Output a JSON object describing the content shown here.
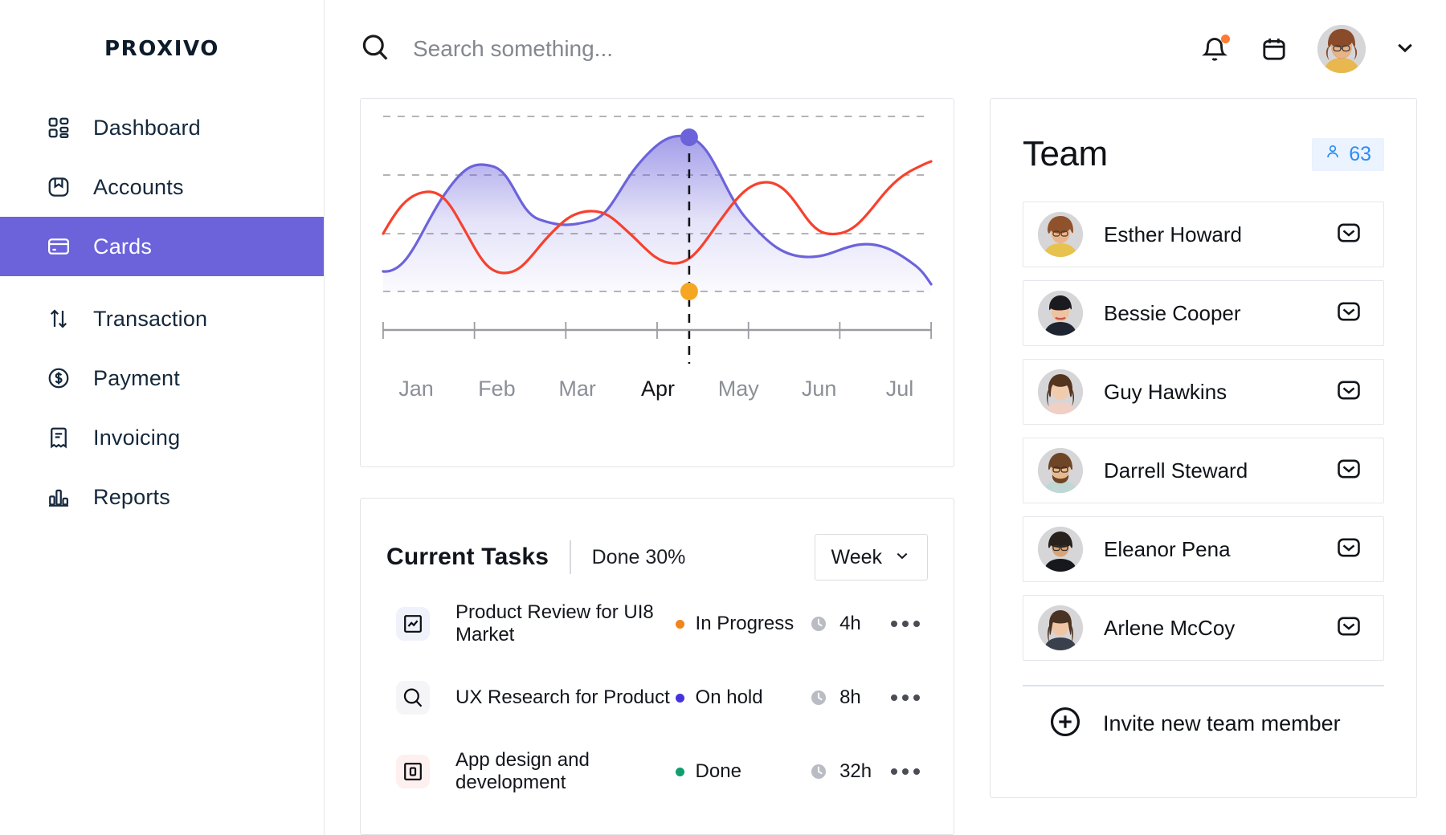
{
  "brand": "PROXIVO",
  "sidebar": {
    "items": [
      {
        "label": "Dashboard",
        "icon": "dashboard-grid-icon",
        "active": false
      },
      {
        "label": "Accounts",
        "icon": "wallet-icon",
        "active": false
      },
      {
        "label": "Cards",
        "icon": "credit-card-icon",
        "active": true
      },
      {
        "label": "Transaction",
        "icon": "arrows-up-down-icon",
        "active": false
      },
      {
        "label": "Payment",
        "icon": "dollar-circle-icon",
        "active": false
      },
      {
        "label": "Invoicing",
        "icon": "invoice-icon",
        "active": false
      },
      {
        "label": "Reports",
        "icon": "bar-chart-icon",
        "active": false
      }
    ],
    "active_color": "#6C63DB"
  },
  "topbar": {
    "search_placeholder": "Search something...",
    "search_value": "",
    "notification_dot_color": "#FF7A33",
    "icons": [
      "search-icon",
      "bell-icon",
      "calendar-icon",
      "chevron-down-icon"
    ]
  },
  "chart_data": {
    "type": "area",
    "title": "",
    "xlabel": "",
    "ylabel": "",
    "grid": true,
    "legend": "none",
    "categories": [
      "Jan",
      "Feb",
      "Mar",
      "Apr",
      "May",
      "Jun",
      "Jul"
    ],
    "highlighted_category": "Apr",
    "gridlines": [
      100,
      75,
      50,
      18
    ],
    "ylim": [
      0,
      110
    ],
    "series": [
      {
        "name": "Primary",
        "color": "#6C63DB",
        "fill": "rgba(108,99,219,0.45)",
        "values": [
          22,
          62,
          48,
          100,
          45,
          32,
          22
        ]
      },
      {
        "name": "Secondary",
        "color": "#F7412D",
        "fill": "none",
        "values": [
          50,
          58,
          20,
          56,
          28,
          72,
          50
        ]
      }
    ],
    "markers": [
      {
        "category": "Apr",
        "value": 100,
        "color": "#6C63DB",
        "label": ""
      },
      {
        "category": "Apr",
        "value": 18,
        "color": "#F5A623",
        "label": ""
      }
    ]
  },
  "tasks": {
    "title": "Current Tasks",
    "done_label": "Done 30%",
    "range_label": "Week",
    "items": [
      {
        "name": "Product Review for UI8 Market",
        "icon": "chart-square-icon",
        "icon_bg": "#eff2fb",
        "status": "In Progress",
        "status_color": "#F08518",
        "time": "4h"
      },
      {
        "name": "UX Research for Product",
        "icon": "magnifier-icon",
        "icon_bg": "#f5f5f7",
        "status": "On hold",
        "status_color": "#4433DD",
        "time": "8h"
      },
      {
        "name": "App design and development",
        "icon": "app-square-icon",
        "icon_bg": "#fdf0ef",
        "status": "Done",
        "status_color": "#0E9F6E",
        "time": "32h"
      }
    ]
  },
  "team": {
    "title": "Team",
    "count_badge": "63",
    "badge_icon": "person-icon",
    "badge_bg": "#EAF3FE",
    "badge_color": "#2D8CF7",
    "members": [
      {
        "name": "Esther Howard",
        "action_icon": "mail-icon"
      },
      {
        "name": "Bessie Cooper",
        "action_icon": "mail-icon"
      },
      {
        "name": "Guy Hawkins",
        "action_icon": "mail-icon"
      },
      {
        "name": "Darrell Steward",
        "action_icon": "mail-icon"
      },
      {
        "name": "Eleanor Pena",
        "action_icon": "mail-icon"
      },
      {
        "name": "Arlene McCoy",
        "action_icon": "mail-icon"
      }
    ],
    "invite_label": "Invite new team member",
    "invite_icon": "plus-circle-icon"
  }
}
